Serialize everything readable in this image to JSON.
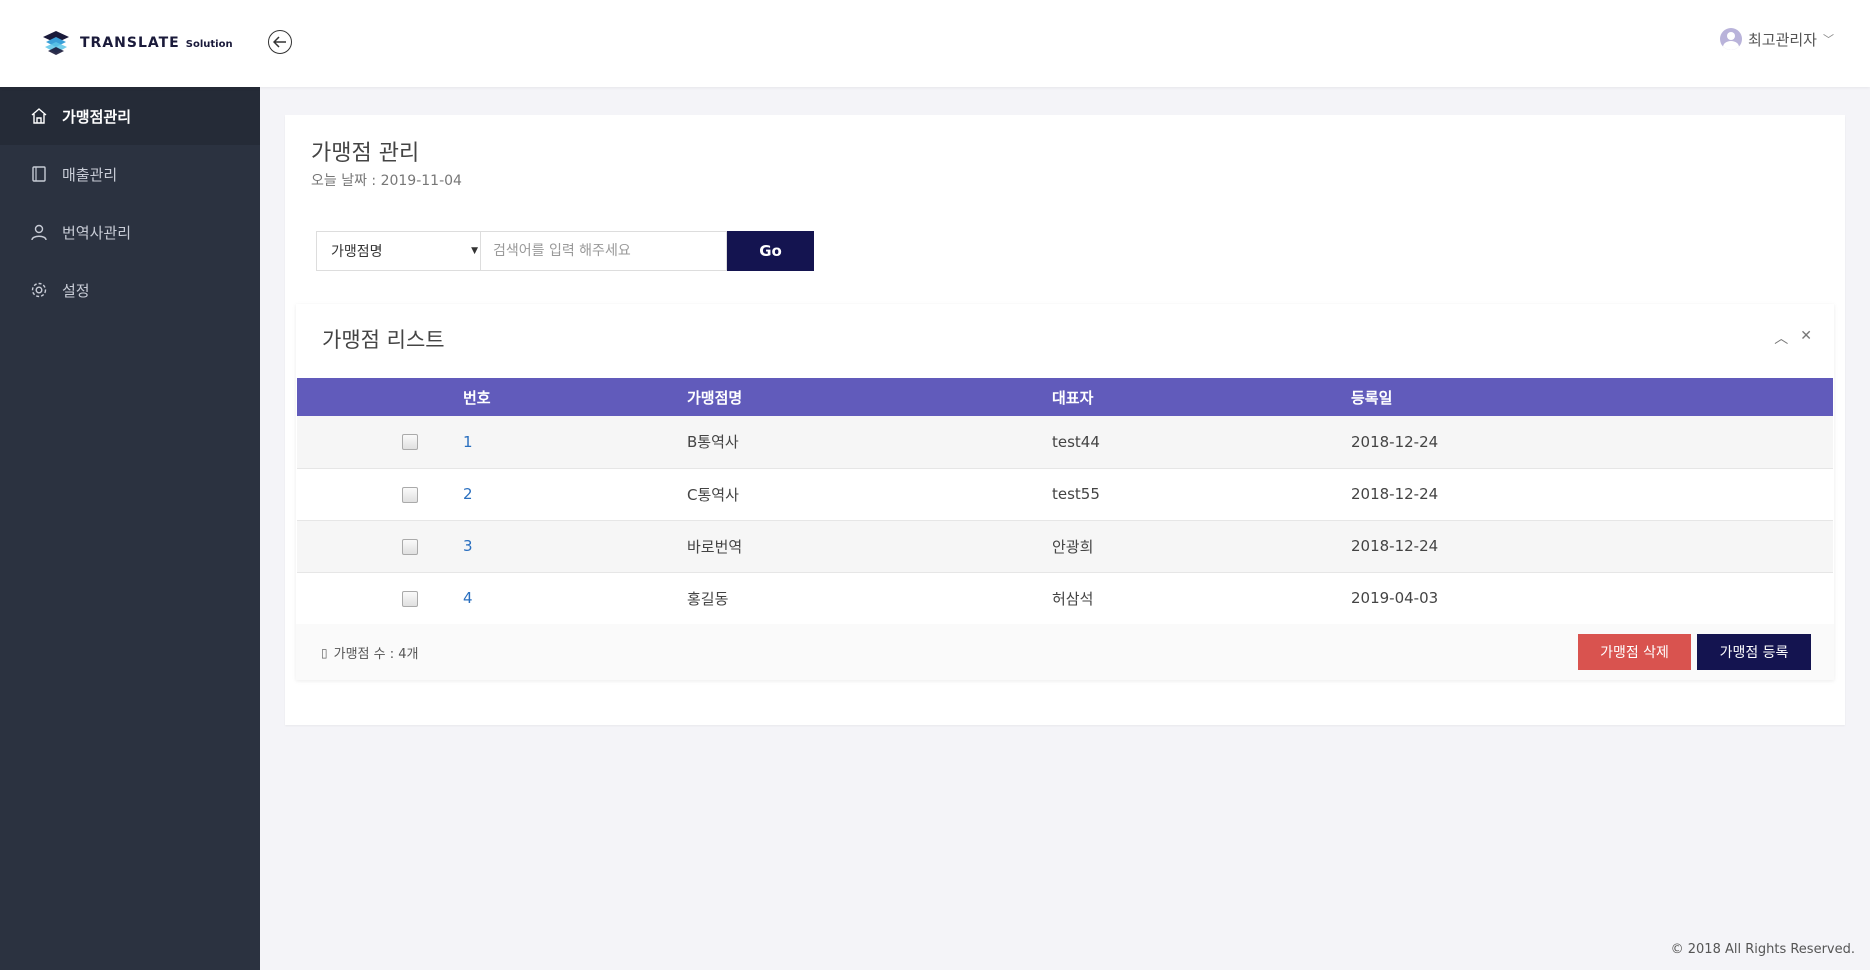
{
  "header": {
    "logo_text": "TRANSLATE",
    "logo_sub": "Solution",
    "user_name": "최고관리자"
  },
  "sidebar": {
    "items": [
      {
        "label": "가맹점관리",
        "icon": "home-icon",
        "active": true
      },
      {
        "label": "매출관리",
        "icon": "book-icon",
        "active": false
      },
      {
        "label": "번역사관리",
        "icon": "user-icon",
        "active": false
      },
      {
        "label": "설정",
        "icon": "gear-icon",
        "active": false
      }
    ]
  },
  "page": {
    "title": "가맹점 관리",
    "date_text": "오늘 날짜 : 2019-11-04"
  },
  "search": {
    "select_value": "가맹점명",
    "placeholder": "검색어를 입력 해주세요",
    "go_label": "Go"
  },
  "list": {
    "title": "가맹점 리스트",
    "columns": [
      "번호",
      "가맹점명",
      "대표자",
      "등록일"
    ],
    "rows": [
      {
        "num": "1",
        "name": "B통역사",
        "rep": "test44",
        "date": "2018-12-24"
      },
      {
        "num": "2",
        "name": "C통역사",
        "rep": "test55",
        "date": "2018-12-24"
      },
      {
        "num": "3",
        "name": "바로번역",
        "rep": "안광희",
        "date": "2018-12-24"
      },
      {
        "num": "4",
        "name": "홍길동",
        "rep": "허삼석",
        "date": "2019-04-03"
      }
    ],
    "count_text": "가맹점 수 : 4개",
    "delete_label": "가맹점 삭제",
    "register_label": "가맹점 등록"
  },
  "footer": {
    "copyright": "© 2018 All Rights Reserved."
  },
  "colors": {
    "sidebar_bg": "#2b3240",
    "table_header": "#615bbb",
    "primary_dark": "#141450",
    "danger": "#d9534f"
  }
}
